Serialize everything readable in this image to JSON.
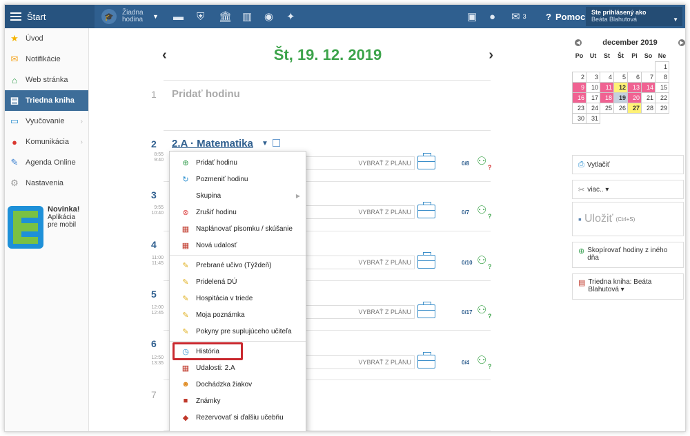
{
  "topbar": {
    "start_label": "Štart",
    "class_label": "Žiadna hodina",
    "mail_count": "3",
    "help_label": "Pomoc",
    "user_label": "Ste prihlásený ako",
    "user_name": "Beáta Blahutová"
  },
  "sidebar": {
    "items": [
      {
        "label": "Úvod",
        "icon": "star-icon"
      },
      {
        "label": "Notifikácie",
        "icon": "mail-icon"
      },
      {
        "label": "Web stránka",
        "icon": "home-icon"
      },
      {
        "label": "Triedna kniha",
        "icon": "book-icon"
      },
      {
        "label": "Vyučovanie",
        "icon": "open-book-icon"
      },
      {
        "label": "Komunikácia",
        "icon": "chat-icon"
      },
      {
        "label": "Agenda Online",
        "icon": "pen-icon"
      },
      {
        "label": "Nastavenia",
        "icon": "gear-icon"
      }
    ],
    "promo": {
      "title": "Novinka!",
      "line1": "Aplikácia",
      "line2": "pre mobil"
    }
  },
  "main": {
    "date": "Št, 19. 12. 2019",
    "add_lesson": "Pridať hodinu",
    "lesson_title": "2.A · Matematika",
    "plan_button": "VYBRAŤ Z PLÁNU",
    "lessons": [
      {
        "num": "1",
        "time_from": "",
        "time_to": ""
      },
      {
        "num": "2",
        "time_from": "8:55",
        "time_to": "9:40",
        "att": "0/8"
      },
      {
        "num": "3",
        "time_from": "9:55",
        "time_to": "10:40",
        "att": "0/7"
      },
      {
        "num": "4",
        "time_from": "11:00",
        "time_to": "11:45",
        "att": "0/10"
      },
      {
        "num": "5",
        "time_from": "12:00",
        "time_to": "12:45",
        "att": "0/17"
      },
      {
        "num": "6",
        "time_from": "12:50",
        "time_to": "13:35",
        "att": "0/4"
      },
      {
        "num": "7",
        "time_from": "",
        "time_to": ""
      }
    ]
  },
  "menu": {
    "items": [
      {
        "label": "Pridať hodinu",
        "icon": "plus-circle-icon"
      },
      {
        "label": "Pozmeniť hodinu",
        "icon": "refresh-icon"
      },
      {
        "label": "Skupina",
        "icon": ""
      },
      {
        "label": "Zrušiť hodinu",
        "icon": "cancel-circle-icon"
      },
      {
        "label": "Naplánovať písomku / skúšanie",
        "icon": "books-icon"
      },
      {
        "label": "Nová udalosť",
        "icon": "books-icon"
      },
      {
        "label": "Prebrané učivo (Týždeň)",
        "icon": "pencil-icon"
      },
      {
        "label": "Pridelená DÚ",
        "icon": "pencil-icon"
      },
      {
        "label": "Hospitácia v triede",
        "icon": "pencil-icon"
      },
      {
        "label": "Moja poznámka",
        "icon": "pencil-icon"
      },
      {
        "label": "Pokyny pre suplujúceho učiteľa",
        "icon": "pencil-icon"
      },
      {
        "label": "História",
        "icon": "clock-icon"
      },
      {
        "label": "Udalosti: 2.A",
        "icon": "books-icon"
      },
      {
        "label": "Dochádzka žiakov",
        "icon": "person-icon"
      },
      {
        "label": "Známky",
        "icon": "grade-book-icon"
      },
      {
        "label": "Rezervovať si ďalšiu učebňu",
        "icon": "room-icon"
      }
    ]
  },
  "calendar": {
    "month": "december 2019",
    "weekdays": [
      "Po",
      "Ut",
      "St",
      "Št",
      "Pi",
      "So",
      "Ne"
    ]
  },
  "right": {
    "print": "Vytlačiť",
    "more": "viac.. ▾",
    "save": "Uložiť",
    "save_hint": "(Ctrl+S)",
    "copy": "Skopírovať hodiny z iného dňa",
    "classbook": "Triedna kniha: Beáta Blahutová ▾"
  }
}
